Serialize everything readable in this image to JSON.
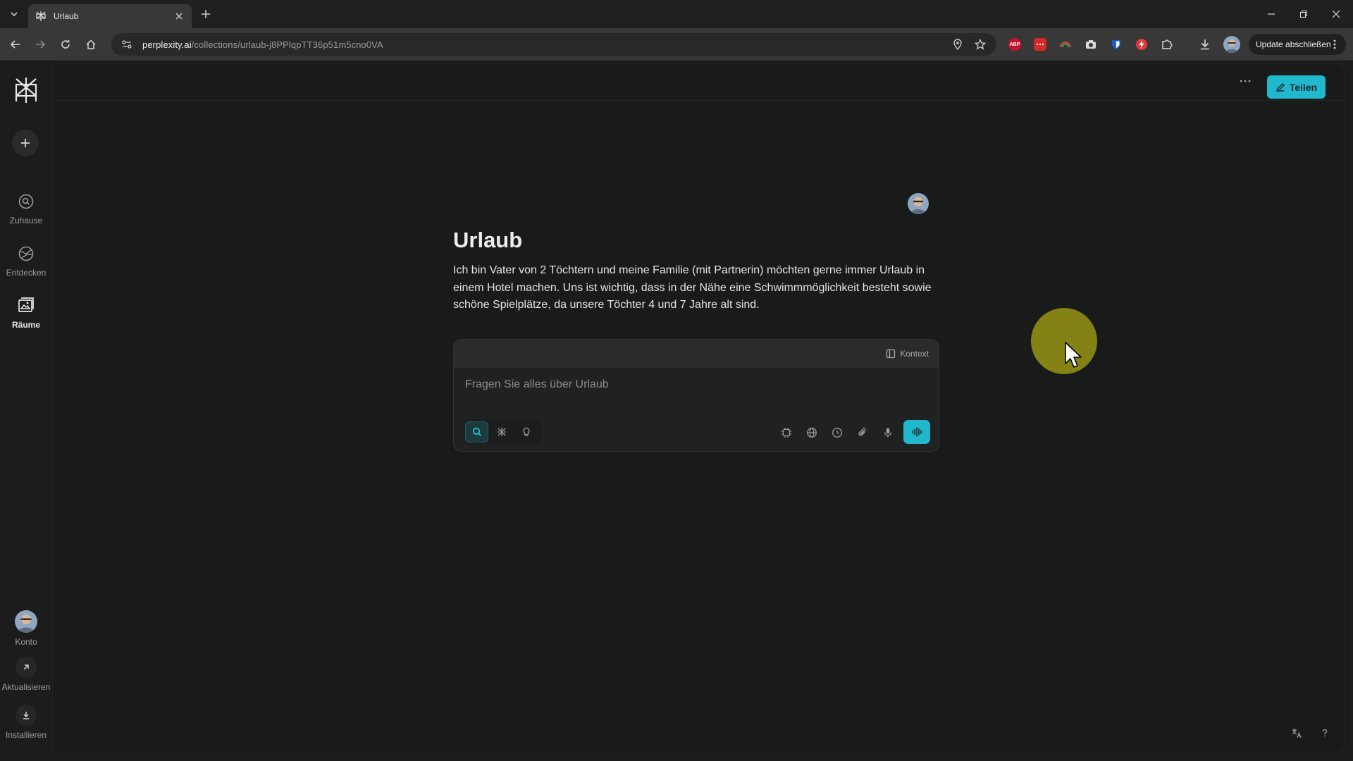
{
  "browser": {
    "tab_title": "Urlaub",
    "url_host": "perplexity.ai",
    "url_path": "/collections/urlaub-j8PPlqpTT36p51m5cno0VA",
    "update_label": "Update abschließen",
    "extension_labels": {
      "abp": "ABP"
    }
  },
  "sidebar": {
    "items": [
      {
        "label": "Zuhause",
        "icon": "search-circle-icon"
      },
      {
        "label": "Entdecken",
        "icon": "globe-icon"
      },
      {
        "label": "Räume",
        "icon": "spaces-icon",
        "active": true
      }
    ],
    "bottom": [
      {
        "label": "Konto",
        "icon": "avatar"
      },
      {
        "label": "Aktualisieren",
        "icon": "arrow-up-right-icon"
      },
      {
        "label": "Installieren",
        "icon": "download-icon"
      }
    ]
  },
  "header": {
    "share_label": "Teilen"
  },
  "space": {
    "title": "Urlaub",
    "description": "Ich bin Vater von 2 Töchtern und meine Familie (mit Partnerin) möchten gerne immer Urlaub in einem Hotel machen. Uns ist wichtig, dass in der Nähe eine Schwimmmöglichkeit besteht sowie schöne Spielplätze, da unsere Töchter 4 und 7 Jahre alt sind."
  },
  "ask": {
    "context_label": "Kontext",
    "placeholder": "Fragen Sie alles über Urlaub",
    "value": ""
  },
  "colors": {
    "accent": "#20b8cd",
    "background": "#191a1a",
    "cursor_halo": "#8d8b13"
  }
}
